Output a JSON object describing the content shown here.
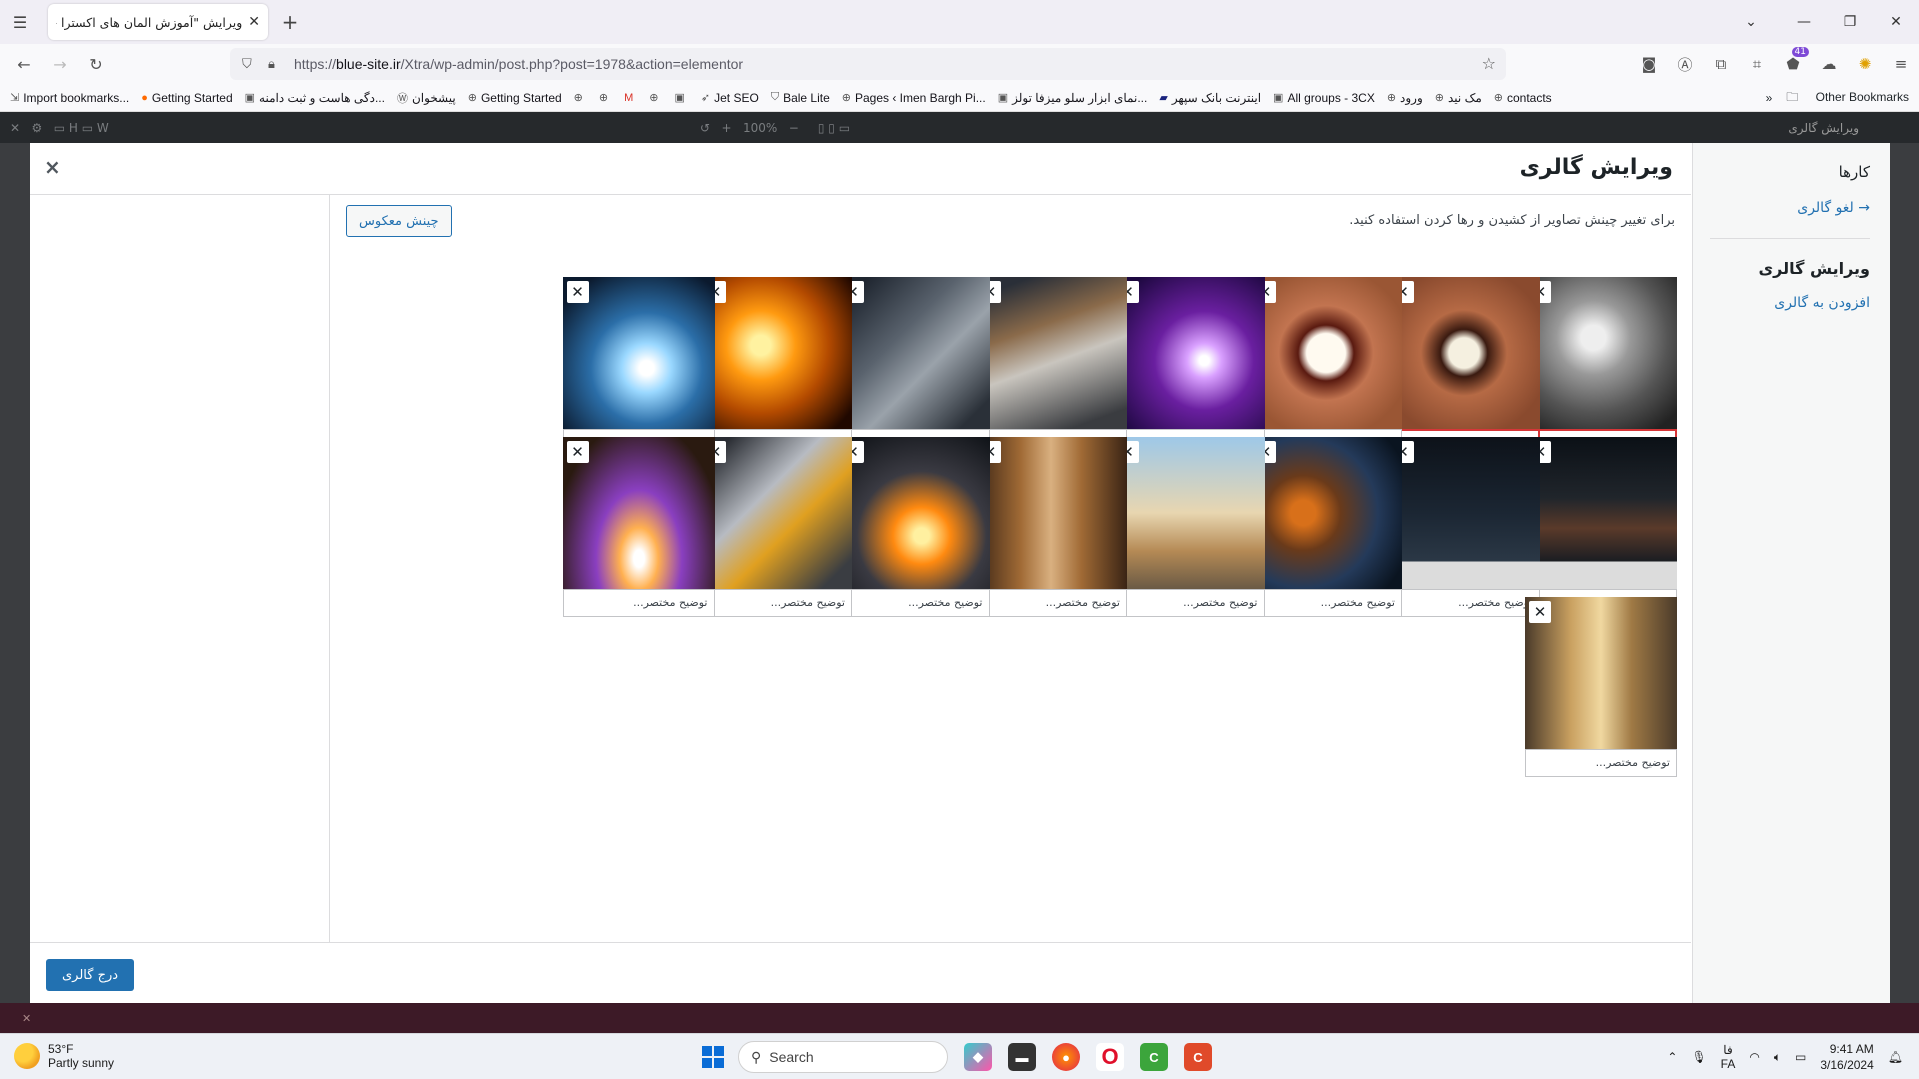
{
  "browser": {
    "tab_title": "ویرایش \"آموزش المان های اکسترا –",
    "url_prefix": "https://",
    "url_host": "blue-site.ir",
    "url_path": "/Xtra/wp-admin/post.php?post=1978&action=elementor",
    "bookmarks": [
      {
        "label": "Import bookmarks...",
        "icon": "import-icon"
      },
      {
        "label": "Getting Started",
        "icon": "firefox-icon"
      },
      {
        "label": "دگی هاست و ثبت دامنه...",
        "icon": "site-icon"
      },
      {
        "label": "پیشخوان",
        "icon": "wordpress-icon"
      },
      {
        "label": "Getting Started",
        "icon": "globe-icon"
      },
      {
        "label": "",
        "icon": "globe-icon"
      },
      {
        "label": "",
        "icon": "globe-icon"
      },
      {
        "label": "",
        "icon": "gmail-icon"
      },
      {
        "label": "",
        "icon": "globe-icon"
      },
      {
        "label": "",
        "icon": "site-icon"
      },
      {
        "label": "Jet SEO",
        "icon": "rocket-icon"
      },
      {
        "label": "Bale Lite",
        "icon": "shield-icon"
      },
      {
        "label": "Pages ‹ Imen Bargh Pi...",
        "icon": "globe-icon"
      },
      {
        "label": "نمای ابزار سلو میزفا تولز...",
        "icon": "site-icon"
      },
      {
        "label": "اینترنت بانک سپهر",
        "icon": "bank-icon"
      },
      {
        "label": "All groups - 3CX",
        "icon": "site-icon"
      },
      {
        "label": "ورود",
        "icon": "globe-icon"
      },
      {
        "label": "مک نید",
        "icon": "globe-icon"
      },
      {
        "label": "contacts",
        "icon": "globe-icon"
      }
    ],
    "other_bookmarks": "Other Bookmarks",
    "badge_count": "41"
  },
  "editor": {
    "zoom": "100%",
    "panel_title": "ویرایش گالری"
  },
  "modal": {
    "title": "ویرایش گالری",
    "close": "×",
    "sidebar": {
      "heading": "کارها",
      "cancel_link": "→ لغو گالری",
      "edit_heading": "ویرایش گالری",
      "add_link": "افزودن به گالری"
    },
    "instructions": "برای تغییر چینش تصاویر از کشیدن و رها کردن استفاده کنید.",
    "reverse_button": "چینش معکوس",
    "caption_placeholder": "توضیح مختصر...",
    "insert_button": "درج گالری",
    "images": [
      {
        "name": "genie-lamp-image",
        "kind": "genie"
      },
      {
        "name": "smile-before-image",
        "kind": "smile2"
      },
      {
        "name": "smile-after-image",
        "kind": "smile"
      },
      {
        "name": "welding-purple-image",
        "kind": "purple"
      },
      {
        "name": "car-factory-image",
        "kind": "factory"
      },
      {
        "name": "engine-worker-image",
        "kind": "engine"
      },
      {
        "name": "foundry-image",
        "kind": "foundry"
      },
      {
        "name": "welding-sparks-image",
        "kind": "weld"
      },
      {
        "name": "smoke-fire-image",
        "kind": "smoke"
      },
      {
        "name": "oil-pump-image",
        "kind": "oil"
      },
      {
        "name": "dark-smoke-image",
        "kind": "darksmoke"
      },
      {
        "name": "construction-worker-image",
        "kind": "construction"
      },
      {
        "name": "corridor-image",
        "kind": "corridor"
      },
      {
        "name": "grinder-sparks-image",
        "kind": "grinder"
      },
      {
        "name": "engine-block-image",
        "kind": "block"
      },
      {
        "name": "laser-cut-image",
        "kind": "laser"
      },
      {
        "name": "refinery-image",
        "kind": "refinery"
      }
    ]
  },
  "taskbar": {
    "temp": "53°F",
    "weather": "Partly sunny",
    "search": "Search",
    "lang_top": "فا",
    "lang_bottom": "FA",
    "time": "9:41 AM",
    "date": "3/16/2024"
  }
}
